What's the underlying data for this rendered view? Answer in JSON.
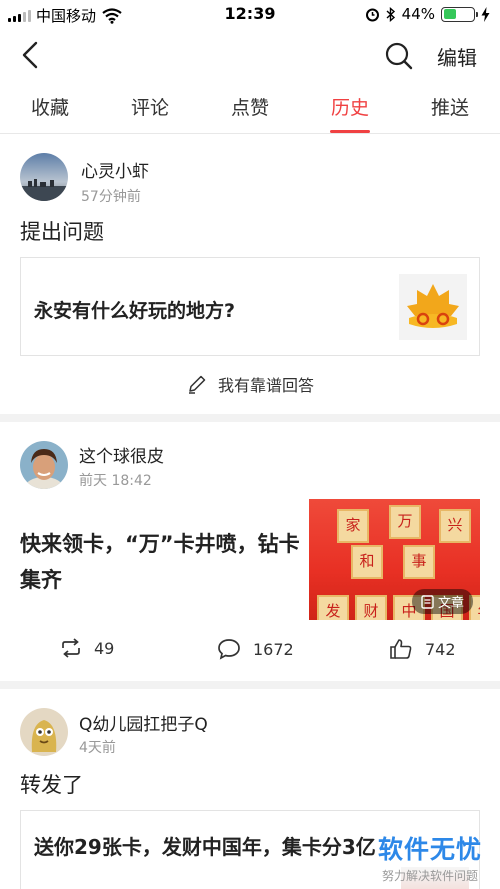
{
  "status_bar": {
    "carrier": "中国移动",
    "time": "12:39",
    "battery": "44%",
    "battery_level": 0.44
  },
  "nav": {
    "edit_label": "编辑"
  },
  "tabs": [
    {
      "label": "收藏"
    },
    {
      "label": "评论"
    },
    {
      "label": "点赞"
    },
    {
      "label": "历史",
      "active": true
    },
    {
      "label": "推送"
    }
  ],
  "accent_color": "#f04142",
  "feed": [
    {
      "user": "心灵小虾",
      "time": "57分钟前",
      "text": "提出问题",
      "question": "永安有什么好玩的地方?",
      "answer_label": "我有靠谱回答"
    },
    {
      "user": "这个球很皮",
      "time": "前天 18:42",
      "title": "快来领卡，“万”卡井喷，钻卡集齐",
      "thumb_chars": [
        "家",
        "万",
        "兴",
        "和",
        "事",
        "发",
        "财",
        "中",
        "国",
        "年"
      ],
      "badge": "文章",
      "reposts": "49",
      "comments": "1672",
      "likes": "742"
    },
    {
      "user": "Q幼儿园扛把子Q",
      "time": "4天前",
      "text": "转发了",
      "quote": "送你29张卡，发财中国年，集卡分3亿"
    }
  ],
  "watermark": {
    "title": "软件无忧",
    "subtitle": "努力解决软件问题"
  }
}
